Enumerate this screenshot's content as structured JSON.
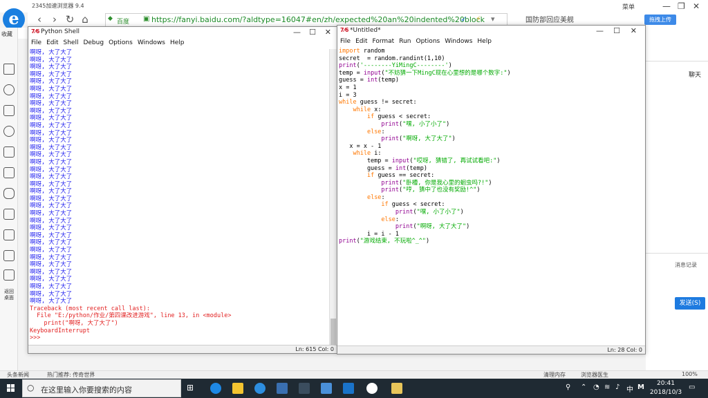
{
  "browser": {
    "title": "2345加速浏览器 9.4",
    "url": "https://fanyi.baidu.com/?aldtype=16047#en/zh/expected%20an%20indented%20block",
    "search_engine_label": "百度",
    "news_tab": "国防部回应美舰",
    "menu_label": "菜单",
    "upload_label": "拖拽上传",
    "favorites_label": "收藏",
    "tiles_label": "返回桌面",
    "chat_label": "聊天",
    "message_record_label": "消息记录",
    "send_label": "发送(S)"
  },
  "statusbar": {
    "news": "头条新闻",
    "hot": "热门推荐: 传奇世界",
    "clean_memory": "清理内存",
    "doctor": "浏览器医生",
    "zoom": "100%"
  },
  "taskbar": {
    "search_placeholder": "在这里输入你要搜索的内容",
    "time": "20:41",
    "date": "2018/10/3",
    "ime": "中",
    "ime2": "M"
  },
  "shell": {
    "title": "Python Shell",
    "menus": [
      "File",
      "Edit",
      "Shell",
      "Debug",
      "Options",
      "Windows",
      "Help"
    ],
    "output_line": "啊呀, 大了大了",
    "output_count": 35,
    "traceback": [
      "Traceback (most recent call last):",
      "  File \"E:/python/作业/第四课改进游戏\", line 13, in <module>",
      "    print(\"啊呀, 大了大了\")",
      "KeyboardInterrupt"
    ],
    "prompt": ">>>",
    "status": "Ln: 615 Col: 0"
  },
  "editor": {
    "title": "*Untitled*",
    "menus": [
      "File",
      "Edit",
      "Format",
      "Run",
      "Options",
      "Windows",
      "Help"
    ],
    "status": "Ln: 28 Col: 0",
    "code": [
      [
        [
          "kw",
          "import"
        ],
        [
          "plain",
          " random"
        ]
      ],
      [
        [
          "plain",
          "secret  = random.randint(1,10)"
        ]
      ],
      [
        [
          "bi",
          "print"
        ],
        [
          "plain",
          "("
        ],
        [
          "str",
          "'--------YiMingC--------'"
        ],
        [
          "plain",
          ")"
        ]
      ],
      [
        [
          "plain",
          "temp = "
        ],
        [
          "bi",
          "input"
        ],
        [
          "plain",
          "("
        ],
        [
          "str",
          "\"不妨猜一下MingC现在心里想的是哪个数字:\""
        ],
        [
          "plain",
          ")"
        ]
      ],
      [
        [
          "plain",
          "guess = "
        ],
        [
          "bi",
          "int"
        ],
        [
          "plain",
          "(temp)"
        ]
      ],
      [
        [
          "plain",
          "x = 1"
        ]
      ],
      [
        [
          "plain",
          "i = 3"
        ]
      ],
      [
        [
          "kw",
          "while"
        ],
        [
          "plain",
          " guess != secret:"
        ]
      ],
      [
        [
          "plain",
          "    "
        ],
        [
          "kw",
          "while"
        ],
        [
          "plain",
          " x:"
        ]
      ],
      [
        [
          "plain",
          "        "
        ],
        [
          "kw",
          "if"
        ],
        [
          "plain",
          " guess < secret:"
        ]
      ],
      [
        [
          "plain",
          "            "
        ],
        [
          "bi",
          "print"
        ],
        [
          "plain",
          "("
        ],
        [
          "str",
          "\"嘿, 小了小了\""
        ],
        [
          "plain",
          ")"
        ]
      ],
      [
        [
          "plain",
          "        "
        ],
        [
          "kw",
          "else"
        ],
        [
          "plain",
          ":"
        ]
      ],
      [
        [
          "plain",
          "            "
        ],
        [
          "bi",
          "print"
        ],
        [
          "plain",
          "("
        ],
        [
          "str",
          "\"啊呀, 大了大了\""
        ],
        [
          "plain",
          ")"
        ]
      ],
      [
        [
          "plain",
          "   x = x - 1"
        ]
      ],
      [
        [
          "plain",
          "    "
        ],
        [
          "kw",
          "while"
        ],
        [
          "plain",
          " i:"
        ]
      ],
      [
        [
          "plain",
          "        temp = "
        ],
        [
          "bi",
          "input"
        ],
        [
          "plain",
          "("
        ],
        [
          "str",
          "\"哎呀, 猜错了, 再试试看吧:\""
        ],
        [
          "plain",
          ")"
        ]
      ],
      [
        [
          "plain",
          "        guess = "
        ],
        [
          "bi",
          "int"
        ],
        [
          "plain",
          "(temp)"
        ]
      ],
      [
        [
          "plain",
          "        "
        ],
        [
          "kw",
          "if"
        ],
        [
          "plain",
          " guess == secret:"
        ]
      ],
      [
        [
          "plain",
          "            "
        ],
        [
          "bi",
          "print"
        ],
        [
          "plain",
          "("
        ],
        [
          "str",
          "\"卧槽, 你是我心里的蛔虫吗?!\""
        ],
        [
          "plain",
          ")"
        ]
      ],
      [
        [
          "plain",
          "            "
        ],
        [
          "bi",
          "print"
        ],
        [
          "plain",
          "("
        ],
        [
          "str",
          "\"哼, 猜中了也没有奖励!^\""
        ],
        [
          "plain",
          ")"
        ]
      ],
      [
        [
          "plain",
          "        "
        ],
        [
          "kw",
          "else"
        ],
        [
          "plain",
          ":"
        ]
      ],
      [
        [
          "plain",
          "            "
        ],
        [
          "kw",
          "if"
        ],
        [
          "plain",
          " guess < secret:"
        ]
      ],
      [
        [
          "plain",
          "                "
        ],
        [
          "bi",
          "print"
        ],
        [
          "plain",
          "("
        ],
        [
          "str",
          "\"嘿, 小了小了\""
        ],
        [
          "plain",
          ")"
        ]
      ],
      [
        [
          "plain",
          "            "
        ],
        [
          "kw",
          "else"
        ],
        [
          "plain",
          ":"
        ]
      ],
      [
        [
          "plain",
          "                "
        ],
        [
          "bi",
          "print"
        ],
        [
          "plain",
          "("
        ],
        [
          "str",
          "\"啊呀, 大了大了\""
        ],
        [
          "plain",
          ")"
        ]
      ],
      [
        [
          "plain",
          "        i = i - 1"
        ]
      ],
      [
        [
          "bi",
          "print"
        ],
        [
          "plain",
          "("
        ],
        [
          "str",
          "\"游戏结束, 不玩啦^_^\""
        ],
        [
          "plain",
          ")"
        ]
      ]
    ]
  },
  "colors": {
    "output_blue": "#1a1aef",
    "error_red": "#e21f1f",
    "keyword_orange": "#ff7700",
    "builtin_purple": "#900090",
    "string_green": "#00aa00",
    "taskbar_bg": "#1f2a33"
  }
}
